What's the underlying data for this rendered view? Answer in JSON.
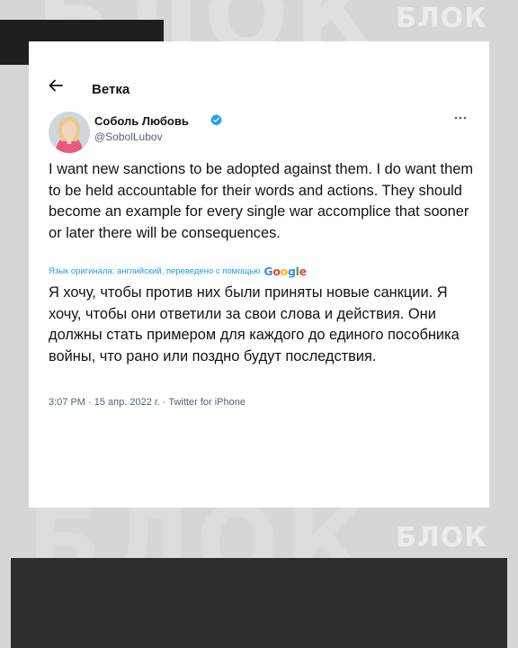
{
  "watermark": {
    "big_text": "БЛОК",
    "logo_text": "БЛОК"
  },
  "header": {
    "back_icon": "arrow-left-icon",
    "title": "Ветка"
  },
  "author": {
    "name": "Соболь Любовь",
    "handle": "@SobolLubov",
    "verified_icon": "verified-badge-icon",
    "more_icon": "more-horizontal-icon"
  },
  "tweet": {
    "original_text": "I want new sanctions to be adopted against them. I do want them to be held accountable for their words and actions. They should become an example for every single war accomplice that sooner or later there will be consequences.",
    "translation_note": "Язык оригинала: английский, переведено с помощью",
    "translation_provider": "Google",
    "translated_text": "Я хочу, чтобы против них были приняты новые санкции. Я хочу, чтобы они ответили за свои слова и действия. Они должны стать примером для каждого до единого пособника войны, что рано или поздно будут последствия.",
    "meta": "3:07 PM · 15 апр. 2022 г. · Twitter for iPhone"
  },
  "colors": {
    "accent": "#1d9bf0",
    "text": "#0f1419",
    "secondary": "#536471"
  }
}
